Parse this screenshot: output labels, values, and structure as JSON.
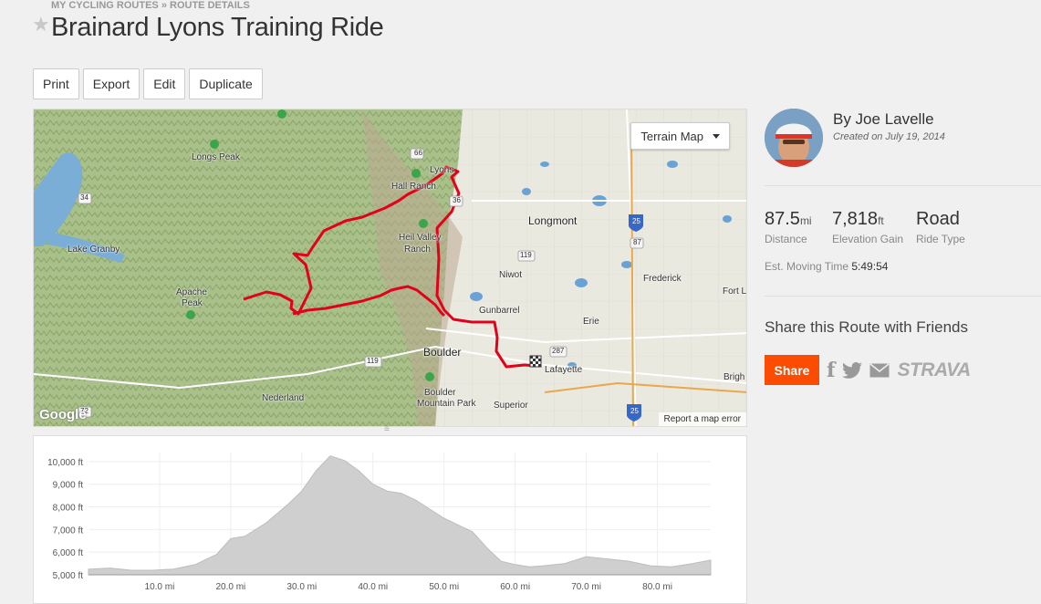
{
  "breadcrumb": {
    "part1": "MY CYCLING ROUTES",
    "sep": "»",
    "part2": "ROUTE DETAILS"
  },
  "page_title": "Brainard Lyons Training Ride",
  "toolbar": {
    "print": "Print",
    "export": "Export",
    "edit": "Edit",
    "duplicate": "Duplicate"
  },
  "map": {
    "layer_select": "Terrain Map",
    "labels": {
      "lyons": "Lyons",
      "hall_ranch": "Hall Ranch",
      "longs_peak": "Longs Peak",
      "longmont": "Longmont",
      "heil_valley": "Heil Valley",
      "ranch": "Ranch",
      "lake_granby": "Lake Granby",
      "niwot": "Niwot",
      "frederick": "Frederick",
      "fort_l": "Fort L",
      "apache": "Apache",
      "peak": "Peak",
      "gunbarrel": "Gunbarrel",
      "erie": "Erie",
      "boulder": "Boulder",
      "lafayette": "Lafayette",
      "bright": "Brigh",
      "nederland": "Nederland",
      "boulder_mp1": "Boulder",
      "boulder_mp2": "Mountain Park",
      "superior": "Superior"
    },
    "shields": {
      "r66": "66",
      "r36": "36",
      "r25a": "25",
      "r25b": "25",
      "r87": "87",
      "r119a": "119",
      "r119b": "119",
      "r287": "287",
      "r34": "34",
      "r72": "72"
    },
    "google": "Google",
    "report": "Report a map error"
  },
  "author": {
    "by": "By Joe Lavelle",
    "created": "Created on July 19, 2014"
  },
  "stats": {
    "distance": {
      "value": "87.5",
      "unit": "mi",
      "label": "Distance"
    },
    "elevation": {
      "value": "7,818",
      "unit": "ft",
      "label": "Elevation Gain"
    },
    "type": {
      "value": "Road",
      "label": "Ride Type"
    }
  },
  "moving_time": {
    "label": "Est. Moving Time",
    "value": "5:49:54"
  },
  "share": {
    "title": "Share this Route with Friends",
    "button": "Share",
    "strava": "STRAVA"
  },
  "colors": {
    "route": "#e3001b",
    "brand": "#fc4c02",
    "elevation_fill": "#cfcfcf"
  },
  "chart_data": {
    "type": "area",
    "xlabel": "",
    "ylabel": "",
    "y_ticks": [
      "5,000 ft",
      "6,000 ft",
      "7,000 ft",
      "8,000 ft",
      "9,000 ft",
      "10,000 ft"
    ],
    "x_ticks": [
      "10.0 mi",
      "20.0 mi",
      "30.0 mi",
      "40.0 mi",
      "50.0 mi",
      "60.0 mi",
      "70.0 mi",
      "80.0 mi"
    ],
    "xlim": [
      0,
      87.5
    ],
    "ylim": [
      5000,
      10400
    ],
    "x": [
      0,
      3,
      6,
      9,
      12,
      15,
      18,
      20,
      22,
      25,
      28,
      30,
      32,
      34,
      36,
      38,
      40,
      42,
      44,
      46,
      48,
      50,
      52,
      54,
      56,
      58,
      60,
      62,
      64,
      67,
      70,
      73,
      76,
      79,
      82,
      85,
      87.5
    ],
    "y": [
      5250,
      5300,
      5200,
      5200,
      5250,
      5450,
      5900,
      6600,
      6700,
      7300,
      8100,
      8700,
      9600,
      10250,
      10050,
      9600,
      9000,
      8700,
      8600,
      8300,
      7900,
      7500,
      7200,
      6900,
      6200,
      5600,
      5450,
      5350,
      5400,
      5500,
      5800,
      5700,
      5600,
      5400,
      5350,
      5500,
      5650
    ]
  }
}
